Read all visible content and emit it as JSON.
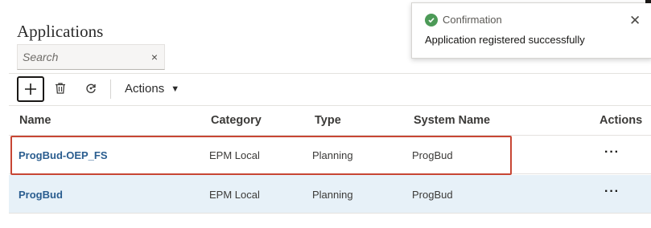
{
  "page": {
    "title": "Applications"
  },
  "search": {
    "placeholder": "Search",
    "value": "",
    "clear_glyph": "×"
  },
  "toolbar": {
    "add_icon": "plus-icon",
    "delete_icon": "trash-icon",
    "refresh_icon": "refresh-icon",
    "actions_label": "Actions",
    "actions_caret": "▼"
  },
  "table": {
    "columns": [
      "Name",
      "Category",
      "Type",
      "System Name",
      "Actions"
    ],
    "rows": [
      {
        "name": "ProgBud-OEP_FS",
        "category": "EPM Local",
        "type": "Planning",
        "system_name": "ProgBud",
        "actions": "···",
        "highlighted": true
      },
      {
        "name": "ProgBud",
        "category": "EPM Local",
        "type": "Planning",
        "system_name": "ProgBud",
        "actions": "···",
        "selected": true
      }
    ]
  },
  "toast": {
    "title": "Confirmation",
    "message": "Application registered successfully",
    "close_glyph": "✕",
    "status_color": "#4c9a57"
  },
  "colors": {
    "link": "#2a5d8f",
    "selected_row": "#e7f1f8",
    "highlight": "#c74634"
  }
}
